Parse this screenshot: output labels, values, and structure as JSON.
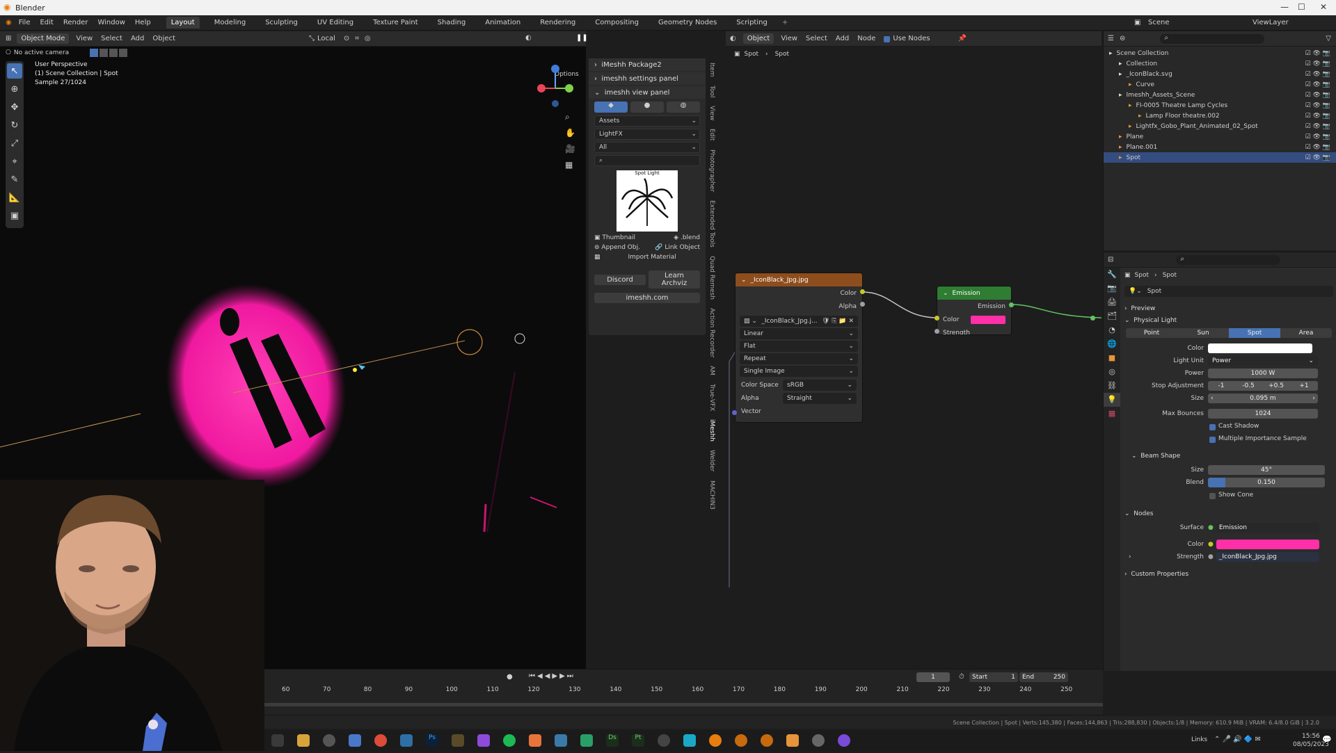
{
  "window": {
    "title": "Blender"
  },
  "menubar": {
    "menus": [
      "File",
      "Edit",
      "Render",
      "Window",
      "Help"
    ],
    "workspaces": [
      "Layout",
      "Modeling",
      "Sculpting",
      "UV Editing",
      "Texture Paint",
      "Shading",
      "Animation",
      "Rendering",
      "Compositing",
      "Geometry Nodes",
      "Scripting"
    ],
    "active_workspace": "Layout",
    "scene": "Scene",
    "view_layer": "ViewLayer"
  },
  "viewport": {
    "mode": "Object Mode",
    "menus": [
      "View",
      "Select",
      "Add",
      "Object"
    ],
    "transform_orientation": "Local",
    "camera": "No active camera",
    "options": "Options",
    "overlay_lines": [
      "User Perspective",
      "(1) Scene Collection | Spot",
      "Sample 27/1024"
    ]
  },
  "imeshh": {
    "package_header": "iMeshh Package2",
    "settings_header": "imeshh settings panel",
    "view_header": "imeshh view panel",
    "dropdown_assets": "Assets",
    "dropdown_category": "LightFX",
    "dropdown_filter": "All",
    "thumb_title": "Spot Light",
    "thumbnail_label": "Thumbnail",
    "blend_label": ".blend",
    "append_label": "Append Obj.",
    "link_label": "Link Object",
    "import_label": "Import Material",
    "discord_label": "Discord",
    "archviz_label": "Learn Archviz",
    "site_label": "imeshh.com",
    "side_tabs": [
      "Item",
      "Tool",
      "View",
      "Edit",
      "Photographer",
      "Extended Tools",
      "Quad Remesh",
      "Action Recorder",
      "AM",
      "True-VFX",
      "iMeshh",
      "Welder",
      "MACHIN3"
    ]
  },
  "node_editor": {
    "menus": [
      "View",
      "Select",
      "Add",
      "Node"
    ],
    "object_label": "Object",
    "use_nodes": "Use Nodes",
    "breadcrumb": [
      "Spot",
      "Spot"
    ],
    "image_node": {
      "title": "_IconBlack_Jpg.jpg",
      "out_color": "Color",
      "out_alpha": "Alpha",
      "image_name": "_IconBlack_Jpg.j...",
      "interpolation": "Linear",
      "projection": "Flat",
      "extension": "Repeat",
      "source": "Single Image",
      "color_space_label": "Color Space",
      "color_space": "sRGB",
      "alpha_label": "Alpha",
      "alpha": "Straight",
      "in_vector": "Vector"
    },
    "emission_node": {
      "title": "Emission",
      "output": "Emission",
      "color": "Color",
      "strength": "Strength",
      "color_hex": "#ff2fa8"
    }
  },
  "outliner": {
    "items": [
      {
        "label": "Scene Collection",
        "indent": 0
      },
      {
        "label": "Collection",
        "indent": 1
      },
      {
        "label": "_IconBlack.svg",
        "indent": 1
      },
      {
        "label": "Curve",
        "indent": 2
      },
      {
        "label": "Imeshh_Assets_Scene",
        "indent": 1
      },
      {
        "label": "FI-0005 Theatre Lamp Cycles",
        "indent": 2
      },
      {
        "label": "Lamp Floor theatre.002",
        "indent": 3
      },
      {
        "label": "Lightfx_Gobo_Plant_Animated_02_Spot",
        "indent": 2
      },
      {
        "label": "Plane",
        "indent": 1
      },
      {
        "label": "Plane.001",
        "indent": 1
      },
      {
        "label": "Spot",
        "indent": 1
      }
    ],
    "selected": "Spot"
  },
  "properties": {
    "breadcrumb": [
      "Spot",
      "Spot"
    ],
    "datablock": "Spot",
    "preview": "Preview",
    "physical_light": "Physical Light",
    "light_types": [
      "Point",
      "Sun",
      "Spot",
      "Area"
    ],
    "active_type": "Spot",
    "color_label": "Color",
    "light_unit_label": "Light Unit",
    "light_unit": "Power",
    "power_label": "Power",
    "power": "1000 W",
    "stop_label": "Stop Adjustment",
    "stops": [
      "-1",
      "-0.5",
      "+0.5",
      "+1"
    ],
    "size_label": "Size",
    "size": "0.095 m",
    "bounces_label": "Max Bounces",
    "bounces": "1024",
    "cast_shadow": "Cast Shadow",
    "mis": "Multiple Importance Sample",
    "beam_shape": "Beam Shape",
    "beam_size_label": "Size",
    "beam_size": "45°",
    "blend_label": "Blend",
    "blend": "0.150",
    "blend_fraction": 0.15,
    "show_cone": "Show Cone",
    "nodes": "Nodes",
    "surface_label": "Surface",
    "surface": "Emission",
    "node_color_label": "Color",
    "strength_label": "Strength",
    "strength": "_IconBlack_Jpg.jpg",
    "custom_properties": "Custom Properties"
  },
  "timeline": {
    "current_frame": "1",
    "start_label": "Start",
    "start": "1",
    "end_label": "End",
    "end": "250",
    "ticks": [
      "60",
      "70",
      "80",
      "90",
      "100",
      "110",
      "120",
      "130",
      "140",
      "150",
      "160",
      "170",
      "180",
      "190",
      "200",
      "210",
      "220",
      "230",
      "240",
      "250"
    ]
  },
  "statusbar": {
    "stats": "Scene Collection | Spot | Verts:145,380 | Faces:144,863 | Tris:288,830 | Objects:1/8 | Memory: 610.9 MiB | VRAM: 6.4/8.0 GiB | 3.2.0"
  },
  "taskbar": {
    "links": "Links",
    "time": "15:56",
    "date": "08/05/2023"
  }
}
